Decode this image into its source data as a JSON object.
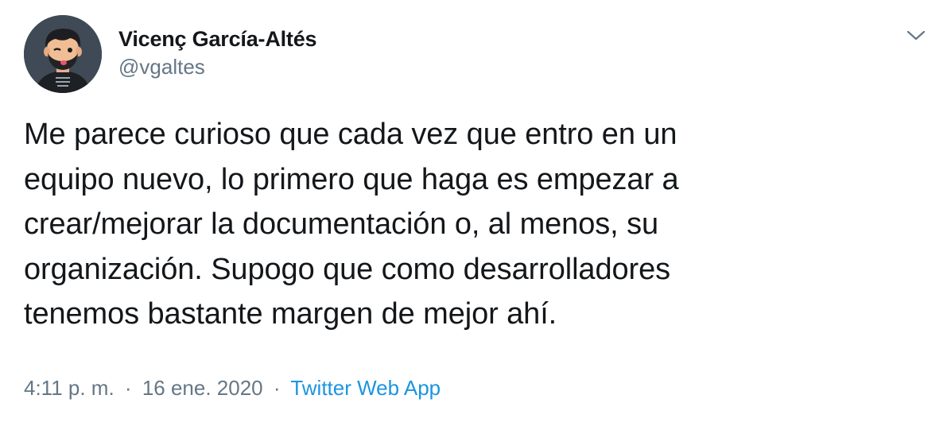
{
  "author": {
    "display_name": "Vicenç García-Altés",
    "handle": "@vgaltes"
  },
  "tweet": {
    "lines": [
      "Me parece curioso que cada vez que entro en un",
      "equipo nuevo, lo primero que haga es empezar a",
      "crear/mejorar la documentación o, al menos, su",
      "organización. Supogo que como desarrolladores",
      "tenemos bastante margen de mejor ahí."
    ]
  },
  "meta": {
    "time": "4:11 p. m.",
    "separator": "·",
    "date": "16 ene. 2020",
    "source": "Twitter Web App"
  },
  "icons": {
    "menu_caret": "chevron-down-icon"
  },
  "colors": {
    "text": "#14171a",
    "secondary": "#657786",
    "link": "#1b95e0"
  }
}
